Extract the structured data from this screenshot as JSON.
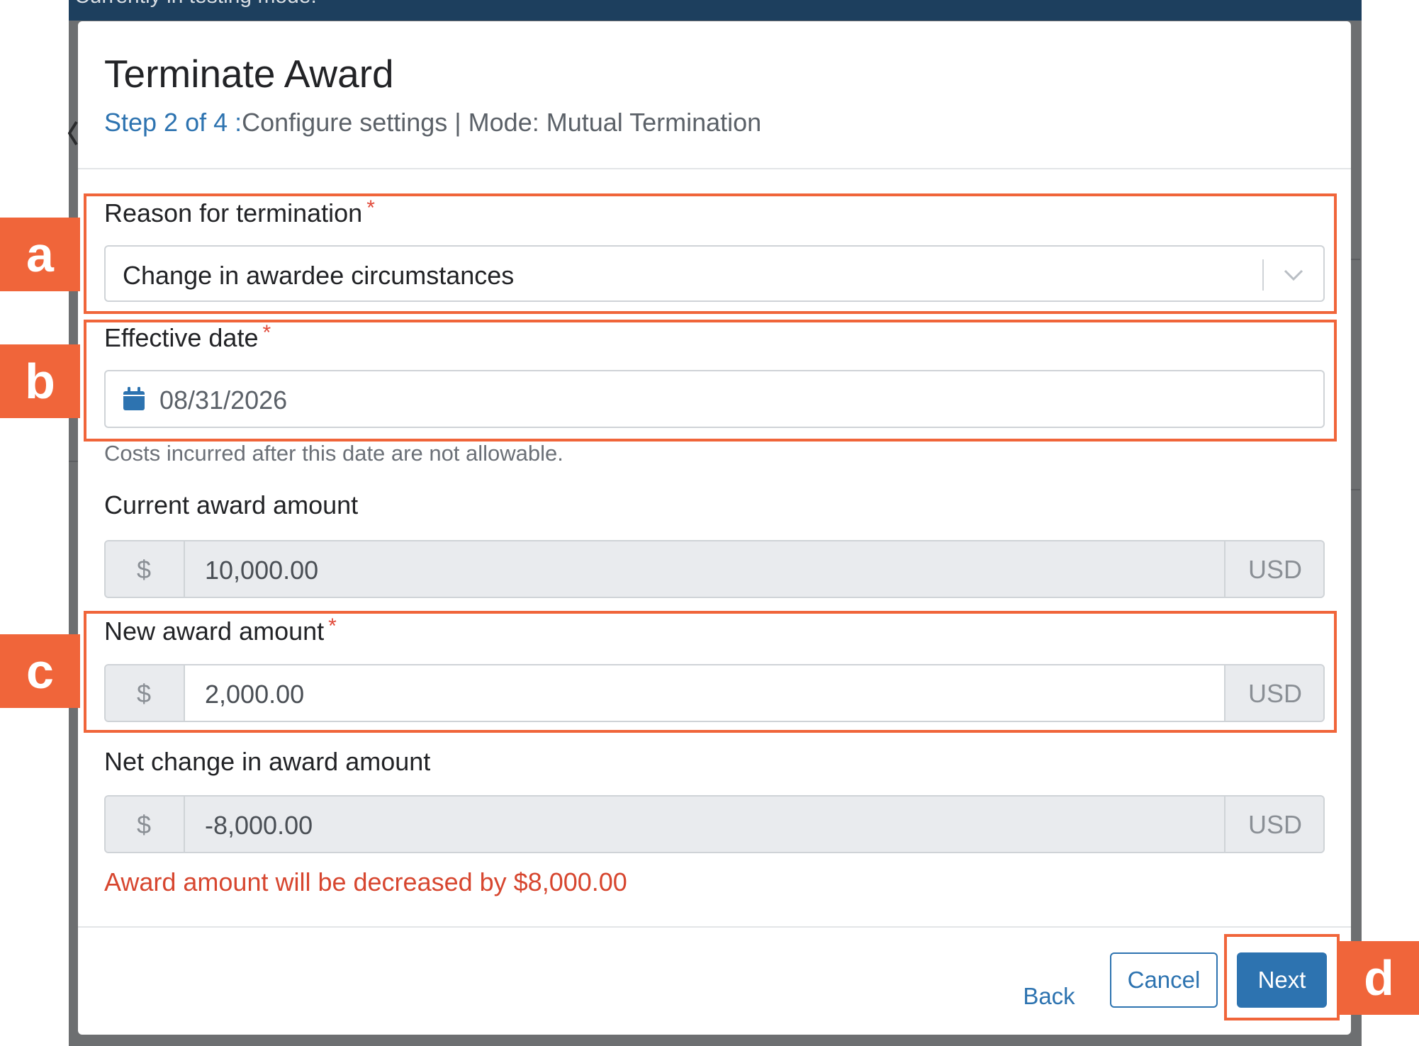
{
  "background": {
    "banner_text": "Currently in testing mode."
  },
  "modal": {
    "title": "Terminate Award",
    "step": "Step 2 of 4 :",
    "step_detail": "Configure settings | Mode: Mutual Termination"
  },
  "form": {
    "reason": {
      "label": "Reason for termination",
      "required_mark": "*",
      "value": "Change in awardee circumstances"
    },
    "effective_date": {
      "label": "Effective date",
      "required_mark": "*",
      "value": "08/31/2026",
      "help": "Costs incurred after this date are not allowable."
    },
    "current_amount": {
      "label": "Current award amount",
      "prefix": "$",
      "value": "10,000.00",
      "suffix": "USD"
    },
    "new_amount": {
      "label": "New award amount",
      "required_mark": "*",
      "prefix": "$",
      "value": "2,000.00",
      "suffix": "USD"
    },
    "net_change": {
      "label": "Net change in award amount",
      "prefix": "$",
      "value": "-8,000.00",
      "suffix": "USD"
    },
    "warning": "Award amount will be decreased by $8,000.00"
  },
  "footer": {
    "back_label": "Back",
    "cancel_label": "Cancel",
    "next_label": "Next"
  },
  "callouts": {
    "a": "a",
    "b": "b",
    "c": "c",
    "d": "d"
  },
  "colors": {
    "accent": "#2d73b0",
    "callout": "#f0653a",
    "required": "#e14b3b",
    "warning": "#d7462f"
  }
}
